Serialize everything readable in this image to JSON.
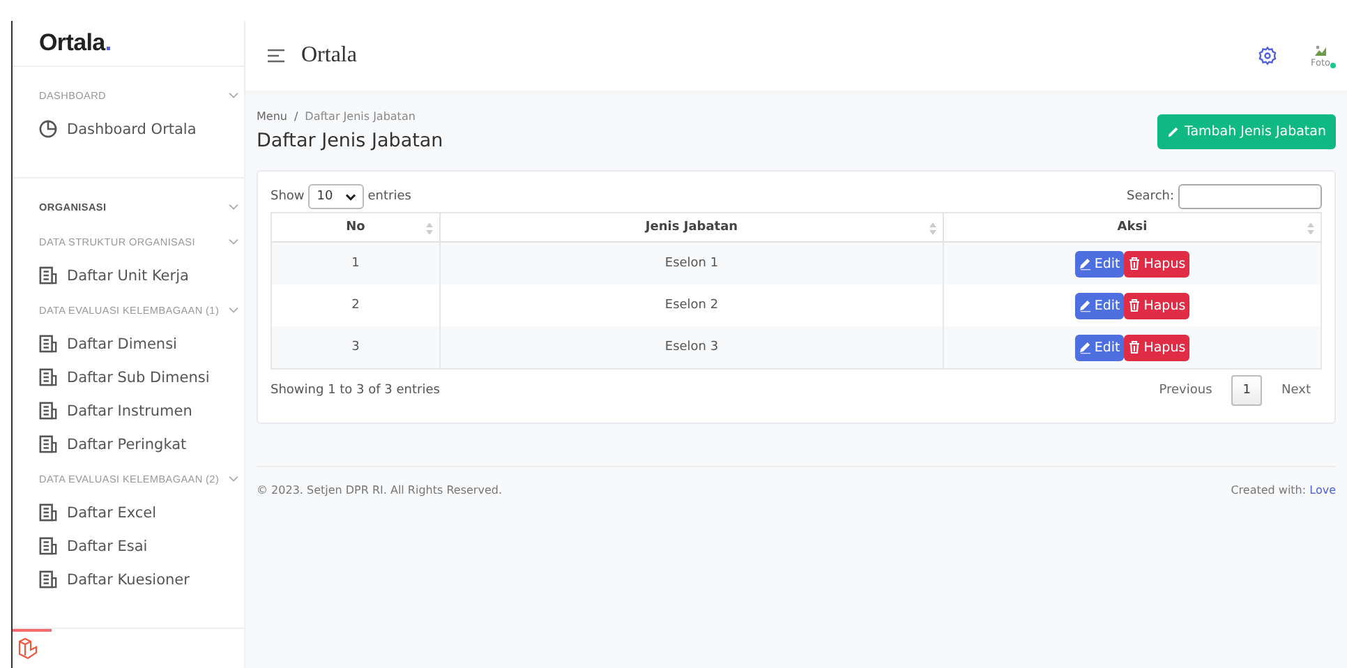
{
  "sidebar": {
    "brand": "Ortala",
    "brand_mark": ".",
    "sections": [
      {
        "groups": [
          {
            "title": "DASHBOARD",
            "strong": false,
            "collapsible": true,
            "items": [
              {
                "label": "Dashboard Ortala",
                "kind": "dashboard"
              }
            ]
          }
        ]
      },
      {
        "groups": [
          {
            "title": "ORGANISASI",
            "strong": true,
            "collapsible": true
          },
          {
            "title": "DATA STRUKTUR ORGANISASI",
            "strong": false,
            "collapsible": true,
            "items": [
              {
                "label": "Daftar Unit Kerja",
                "kind": "list"
              }
            ]
          },
          {
            "title": "DATA EVALUASI KELEMBAGAAN (1)",
            "strong": false,
            "collapsible": true,
            "items": [
              {
                "label": "Daftar Dimensi",
                "kind": "list"
              },
              {
                "label": "Daftar Sub Dimensi",
                "kind": "list"
              },
              {
                "label": "Daftar Instrumen",
                "kind": "list"
              },
              {
                "label": "Daftar Peringkat",
                "kind": "list"
              }
            ]
          },
          {
            "title": "DATA EVALUASI KELEMBAGAAN (2)",
            "strong": false,
            "collapsible": true,
            "items": [
              {
                "label": "Daftar Excel",
                "kind": "list"
              },
              {
                "label": "Daftar Esai",
                "kind": "list"
              },
              {
                "label": "Daftar Kuesioner",
                "kind": "list"
              }
            ]
          }
        ]
      }
    ]
  },
  "header": {
    "title": "Ortala",
    "avatar_alt": "Foto",
    "online": true
  },
  "breadcrumb": {
    "items": [
      "Menu",
      "Daftar Jenis Jabatan"
    ],
    "separator": "/"
  },
  "page_title": "Daftar Jenis Jabatan",
  "add_button": "Tambah Jenis Jabatan",
  "table": {
    "length_prefix": "Show",
    "length_value": "10",
    "length_suffix": "entries",
    "search_label": "Search:",
    "columns": [
      "No",
      "Jenis Jabatan",
      "Aksi"
    ],
    "rows": [
      {
        "no": "1",
        "name": "Eselon 1",
        "actions": [
          "Edit",
          "Hapus"
        ]
      },
      {
        "no": "2",
        "name": "Eselon 2",
        "actions": [
          "Edit",
          "Hapus"
        ]
      },
      {
        "no": "3",
        "name": "Eselon 3",
        "actions": [
          "Edit",
          "Hapus"
        ]
      }
    ],
    "info": "Showing 1 to 3 of 3 entries",
    "pagination": [
      {
        "label": "Previous",
        "selected": false
      },
      {
        "label": "1",
        "selected": true
      },
      {
        "label": "Next",
        "selected": false
      }
    ]
  },
  "footer": {
    "copyright": "© 2023. Setjen DPR RI. All Rights Reserved.",
    "credit": "Created with:",
    "credit_link": "Love"
  }
}
